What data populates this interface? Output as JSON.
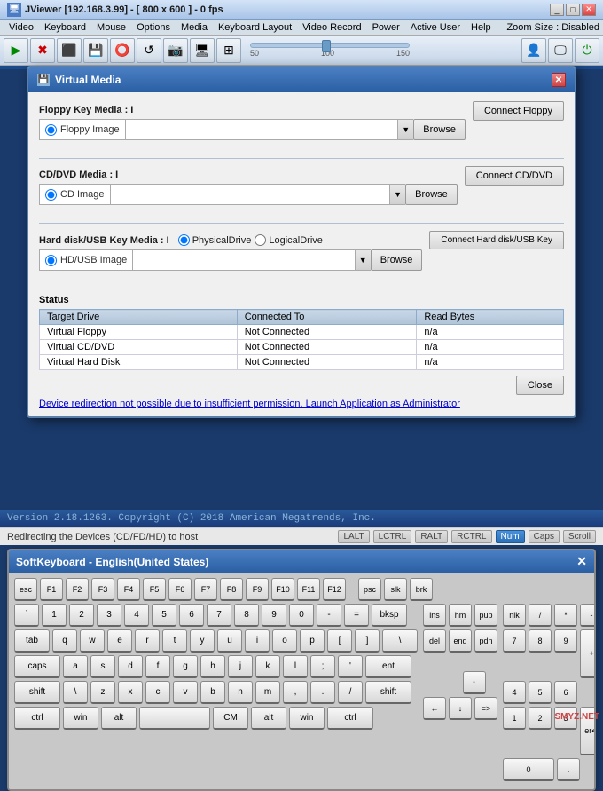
{
  "titlebar": {
    "title": "JViewer [192.168.3.99] - [ 800 x 600 ] - 0 fps",
    "icon": "🖥"
  },
  "menubar": {
    "items": [
      "Video",
      "Keyboard",
      "Mouse",
      "Options",
      "Media",
      "Keyboard Layout",
      "Video Record",
      "Power",
      "Active User",
      "Help"
    ],
    "zoom": "Zoom Size : Disabled"
  },
  "toolbar": {
    "slider_labels": [
      "50",
      "100",
      "150"
    ]
  },
  "dialog": {
    "title": "Virtual Media",
    "close": "✕",
    "floppy_section": {
      "header": "Floppy Key Media : I",
      "radio_label": "Floppy Image",
      "browse": "Browse",
      "connect": "Connect Floppy"
    },
    "cddvd_section": {
      "header": "CD/DVD Media : I",
      "radio_label": "CD Image",
      "browse": "Browse",
      "connect": "Connect CD/DVD"
    },
    "hd_section": {
      "header": "Hard disk/USB Key Media : I",
      "radio1": "PhysicalDrive",
      "radio2": "LogicalDrive",
      "radio_label": "HD/USB Image",
      "browse": "Browse",
      "connect": "Connect Hard disk/USB Key"
    },
    "status": {
      "title": "Status",
      "columns": [
        "Target Drive",
        "Connected To",
        "Read Bytes"
      ],
      "rows": [
        [
          "Virtual Floppy",
          "Not Connected",
          "n/a"
        ],
        [
          "Virtual CD/DVD",
          "Not Connected",
          "n/a"
        ],
        [
          "Virtual Hard Disk",
          "Not Connected",
          "n/a"
        ]
      ]
    },
    "close_btn": "Close",
    "warning": "Device redirection not possible due to insufficient permission. Launch Application as Administrator"
  },
  "bottom_bar": {
    "text": "Version 2.18.1263. Copyright (C) 2018 American Megatrends, Inc."
  },
  "status_strip": {
    "left": "Redirecting the Devices (CD/FD/HD) to host",
    "keys": [
      "LALT",
      "LCTRL",
      "RALT",
      "RCTRL",
      "Num",
      "Caps",
      "Scroll"
    ]
  },
  "softkb": {
    "title": "SoftKeyboard - English(United States)",
    "close": "✕",
    "rows": {
      "fn_row": [
        "esc",
        "F1",
        "F2",
        "F3",
        "F4",
        "F5",
        "F6",
        "F7",
        "F8",
        "F9",
        "F10",
        "F11",
        "F12",
        "psc",
        "slk",
        "brk"
      ],
      "num_row": [
        "`",
        "1",
        "2",
        "3",
        "4",
        "5",
        "6",
        "7",
        "8",
        "9",
        "0",
        "-",
        "=",
        "bksp"
      ],
      "tab_row": [
        "tab",
        "q",
        "w",
        "e",
        "r",
        "t",
        "y",
        "u",
        "i",
        "o",
        "p",
        "[",
        "]",
        "\\"
      ],
      "caps_row": [
        "caps",
        "a",
        "s",
        "d",
        "f",
        "g",
        "h",
        "j",
        "k",
        "l",
        ";",
        "'",
        "ent"
      ],
      "shift_row": [
        "shift",
        "\\",
        "z",
        "x",
        "c",
        "v",
        "b",
        "n",
        "m",
        ",",
        ".",
        "/",
        "shift"
      ],
      "ctrl_row": [
        "ctrl",
        "win",
        "alt",
        "",
        "CM",
        "alt",
        "win",
        "ctrl"
      ],
      "nav_keys": [
        "ins",
        "hm",
        "pup",
        "del",
        "end",
        "pdn"
      ],
      "nav_arrows": [
        "↑",
        "←",
        "↓",
        "→"
      ],
      "numpad_top": [
        "nlk",
        "/",
        "*",
        "-"
      ],
      "numpad_mid1": [
        "7",
        "8",
        "9"
      ],
      "numpad_mid2": [
        "4",
        "5",
        "6"
      ],
      "numpad_mid3": [
        "1",
        "2",
        "3"
      ],
      "numpad_bot": [
        "0",
        "."
      ],
      "numpad_special": [
        "+",
        "er↵"
      ]
    }
  },
  "watermark": "SMYZ.NET"
}
